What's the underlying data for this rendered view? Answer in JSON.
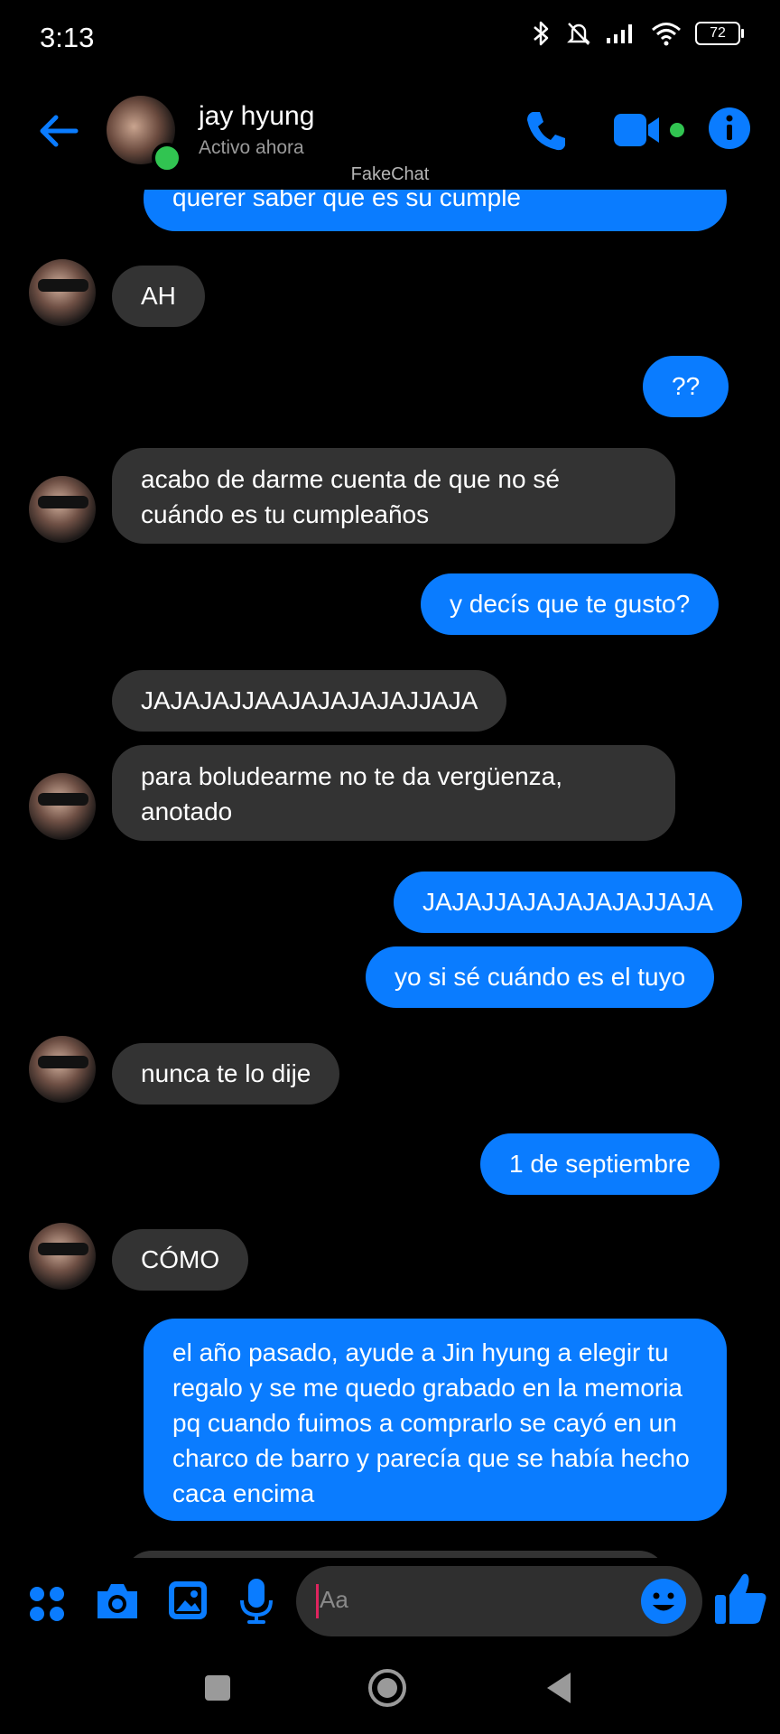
{
  "status_bar": {
    "time": "3:13",
    "battery": "72"
  },
  "header": {
    "contact_name": "jay hyung",
    "status": "Activo ahora",
    "watermark": "FakeChat"
  },
  "messages": [
    {
      "side": "out",
      "text": "querer saber que es su cumple"
    },
    {
      "side": "in",
      "text": "AH"
    },
    {
      "side": "out",
      "text": "??"
    },
    {
      "side": "in",
      "text": "acabo de darme cuenta de que no sé cuándo es tu cumpleaños"
    },
    {
      "side": "out",
      "text": "y decís que te gusto?"
    },
    {
      "side": "in",
      "text": "JAJAJAJJAAJAJAJAJAJJAJA"
    },
    {
      "side": "in",
      "text": "para boludearme no te da vergüenza, anotado"
    },
    {
      "side": "out",
      "text": "JAJAJJAJAJAJAJAJJAJA"
    },
    {
      "side": "out",
      "text": "yo si sé cuándo es el tuyo"
    },
    {
      "side": "in",
      "text": "nunca te lo dije"
    },
    {
      "side": "out",
      "text": "1 de septiembre"
    },
    {
      "side": "in",
      "text": "CÓMO"
    },
    {
      "side": "out",
      "text": "el año pasado, ayude a Jin hyung a elegir tu regalo y se me quedo grabado en la memoria pq cuando fuimos a comprarlo se cayó en un charco de barro y parecía que se había hecho caca encima"
    }
  ],
  "composer": {
    "placeholder": "Aa"
  },
  "colors": {
    "accent": "#0a7cff",
    "incoming": "#333333",
    "online": "#31c451"
  }
}
